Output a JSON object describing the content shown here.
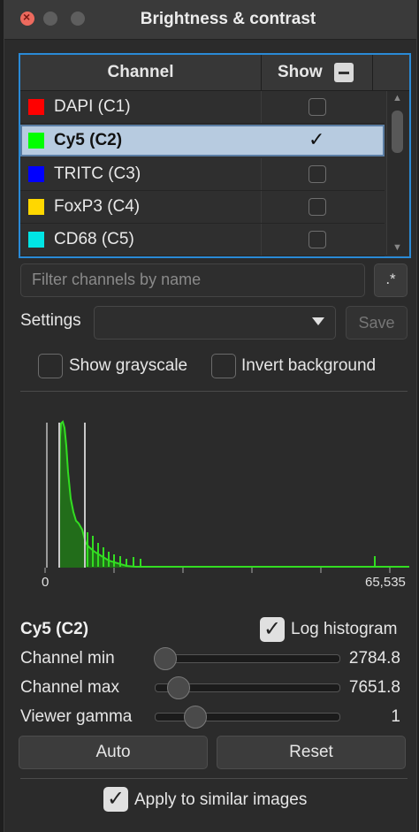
{
  "window": {
    "title": "Brightness & contrast"
  },
  "table": {
    "header_channel": "Channel",
    "header_show": "Show",
    "rows": [
      {
        "name": "DAPI (C1)",
        "color": "#ff0000",
        "checked": false
      },
      {
        "name": "Cy5 (C2)",
        "color": "#00ff00",
        "checked": true
      },
      {
        "name": "TRITC (C3)",
        "color": "#0000ff",
        "checked": false
      },
      {
        "name": "FoxP3 (C4)",
        "color": "#ffd700",
        "checked": false
      },
      {
        "name": "CD68 (C5)",
        "color": "#00e5e5",
        "checked": false
      }
    ],
    "check_glyph": "✓"
  },
  "filter": {
    "placeholder": "Filter channels by name",
    "regex_label": ".*"
  },
  "settings": {
    "label": "Settings",
    "value": "",
    "save_label": "Save"
  },
  "options": {
    "show_grayscale": "Show grayscale",
    "invert_background": "Invert background"
  },
  "histogram": {
    "x_min_label": "0",
    "x_max_label": "65,535",
    "color": "#33dd22",
    "log_label": "Log histogram",
    "log_checked": true
  },
  "channel": {
    "title": "Cy5 (C2)",
    "min_label": "Channel min",
    "min_value": "2784.8",
    "min_fraction": 0.05,
    "max_label": "Channel max",
    "max_value": "7651.8",
    "max_fraction": 0.12,
    "gamma_label": "Viewer gamma",
    "gamma_value": "1",
    "gamma_fraction": 0.21
  },
  "buttons": {
    "auto": "Auto",
    "reset": "Reset"
  },
  "apply": {
    "label": "Apply to similar images",
    "checked": true
  }
}
